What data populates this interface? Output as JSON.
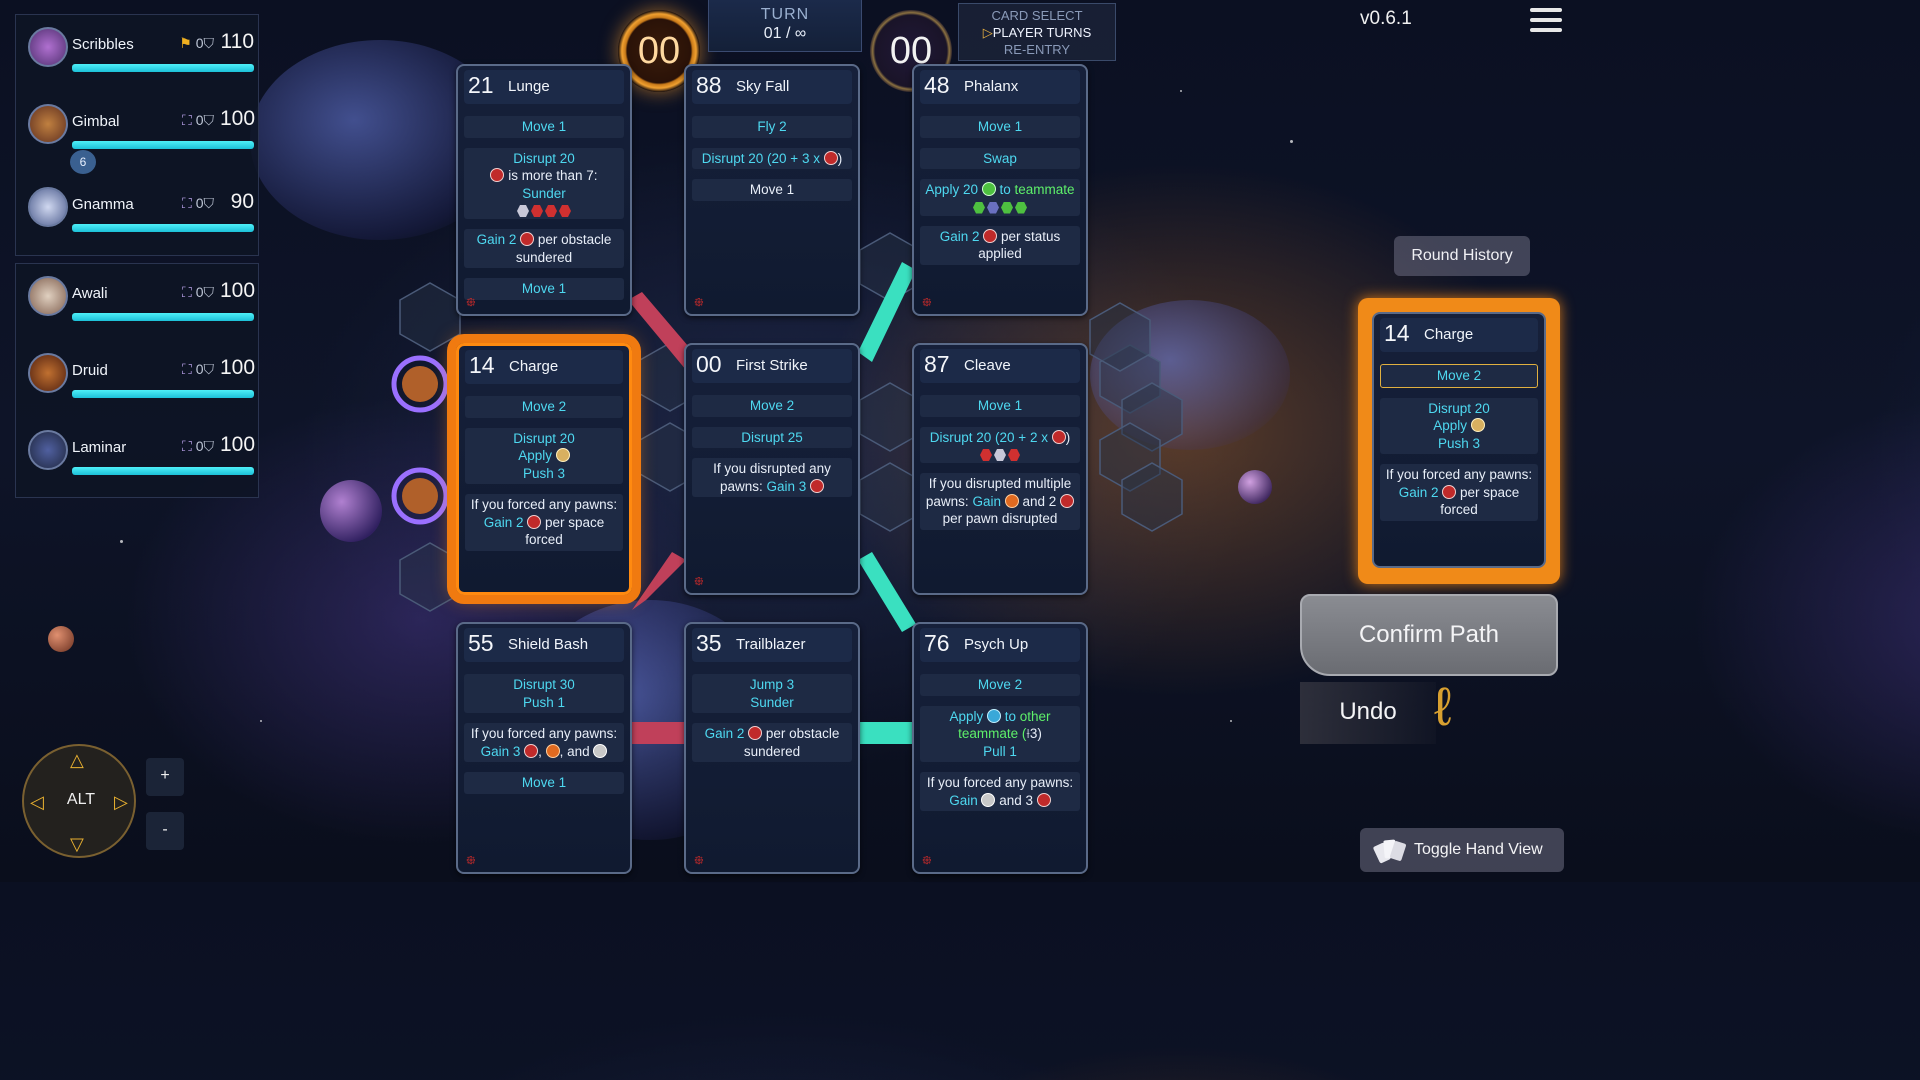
{
  "hud": {
    "turn_label": "TURN",
    "turn_value": "01 / ∞",
    "timer_left": "00",
    "timer_right": "00",
    "phases": [
      "CARD SELECT",
      "PLAYER TURNS",
      "RE-ENTRY"
    ],
    "active_phase_index": 1,
    "version": "v0.6.1"
  },
  "roster_team1": [
    {
      "name": "Scribbles",
      "status": "0",
      "hp": "110",
      "hp_fraction": 1.0,
      "marker": "flag-icon"
    },
    {
      "name": "Gimbal",
      "status": "0",
      "hp": "100",
      "hp_fraction": 1.0,
      "marker": "bracket-icon",
      "buff": "6"
    },
    {
      "name": "Gnamma",
      "status": "0",
      "hp": "90",
      "hp_fraction": 1.0,
      "marker": "bracket-icon"
    }
  ],
  "roster_team2": [
    {
      "name": "Awali",
      "status": "0",
      "hp": "100",
      "hp_fraction": 1.0,
      "marker": "bracket-icon"
    },
    {
      "name": "Druid",
      "status": "0",
      "hp": "100",
      "hp_fraction": 1.0,
      "marker": "bracket-icon"
    },
    {
      "name": "Laminar",
      "status": "0",
      "hp": "100",
      "hp_fraction": 1.0,
      "marker": "bracket-icon"
    }
  ],
  "cards": {
    "lunge": {
      "init": "21",
      "title": "Lunge",
      "move1": "Move 1",
      "disrupt": "Disrupt 20",
      "cond": "is more than 7:",
      "sunder": "Sunder",
      "gain": "Gain 2",
      "gain_tail": "per obstacle sundered",
      "move2": "Move 1"
    },
    "skyfall": {
      "init": "88",
      "title": "Sky Fall",
      "fly": "Fly 2",
      "disrupt": "Disrupt 20 (20 + 3 x",
      "disrupt_tail": ")",
      "move": "Move 1"
    },
    "phalanx": {
      "init": "48",
      "title": "Phalanx",
      "move": "Move 1",
      "swap": "Swap",
      "apply": "Apply 20",
      "to": "to",
      "teammate": "teammate",
      "gain": "Gain 2",
      "gain_tail": "per status applied"
    },
    "charge": {
      "init": "14",
      "title": "Charge",
      "move": "Move 2",
      "disrupt": "Disrupt 20",
      "apply": "Apply",
      "push": "Push 3",
      "if": "If you forced any pawns:",
      "gain": "Gain 2",
      "gain_tail": "per space forced"
    },
    "firststrike": {
      "init": "00",
      "title": "First Strike",
      "move": "Move 2",
      "disrupt": "Disrupt 25",
      "if": "If you disrupted any pawns:",
      "gain": "Gain 3"
    },
    "cleave": {
      "init": "87",
      "title": "Cleave",
      "move": "Move 1",
      "disrupt": "Disrupt 20 (20 + 2 x",
      "disrupt_tail": ")",
      "if": "If you disrupted multiple pawns:",
      "gain": "Gain",
      "and": "and 2",
      "tail": "per pawn disrupted"
    },
    "shieldbash": {
      "init": "55",
      "title": "Shield Bash",
      "disrupt": "Disrupt 30",
      "push": "Push 1",
      "if": "If you forced any pawns:",
      "gain": "Gain 3",
      "mid": ",",
      "and": ", and",
      "move": "Move 1"
    },
    "trailblazer": {
      "init": "35",
      "title": "Trailblazer",
      "jump": "Jump 3",
      "sunder": "Sunder",
      "gain": "Gain 2",
      "gain_tail": "per obstacle sundered"
    },
    "psychup": {
      "init": "76",
      "title": "Psych Up",
      "move": "Move 2",
      "apply": "Apply",
      "to": "to",
      "other": "other",
      "teammate": "teammate (",
      "range": "3)",
      "pull": "Pull 1",
      "if": "If you forced any pawns:",
      "gain": "Gain",
      "and": "and 3"
    }
  },
  "preview": {
    "init": "14",
    "title": "Charge",
    "move": "Move 2",
    "disrupt": "Disrupt 20",
    "apply": "Apply",
    "push": "Push 3",
    "if": "If you forced any pawns:",
    "gain": "Gain 2",
    "gain_tail": "per space forced"
  },
  "buttons": {
    "round_history": "Round History",
    "confirm_path": "Confirm Path",
    "undo": "Undo",
    "toggle_hand": "Toggle Hand View",
    "dpad_center": "ALT",
    "zoom_in": "+",
    "zoom_out": "-"
  },
  "colors": {
    "accent_cyan": "#4ed8f0",
    "selection_orange": "#f08a18",
    "hp_bar": "#2ce0f0"
  }
}
